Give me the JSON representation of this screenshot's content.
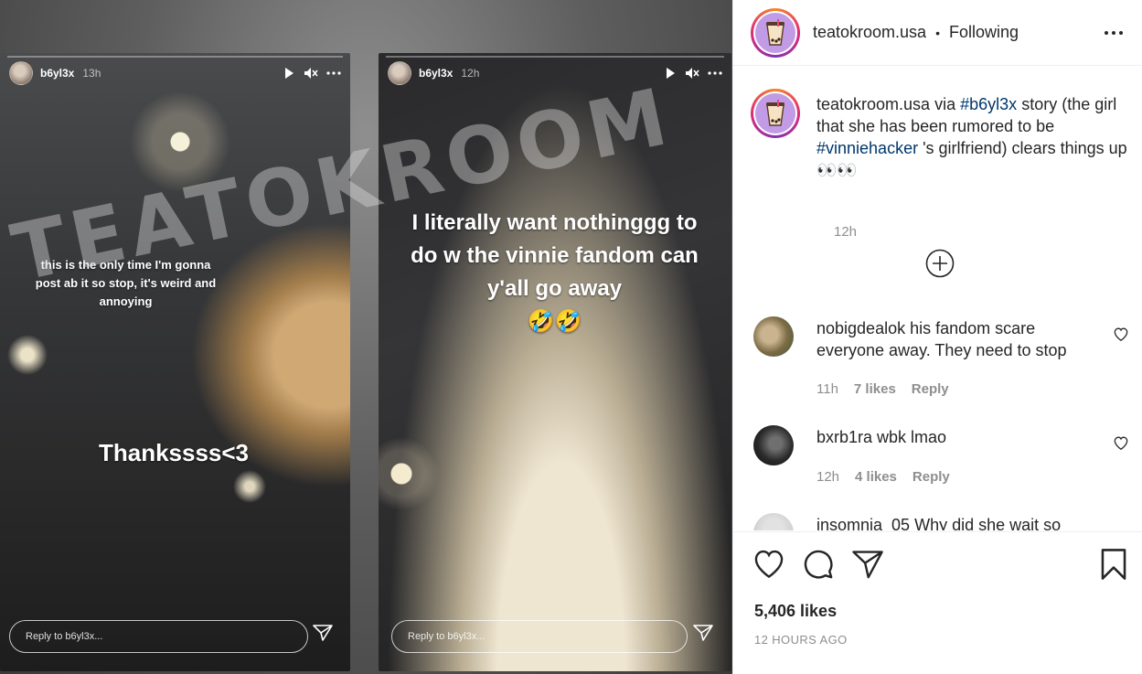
{
  "post": {
    "author": "teatokroom.usa",
    "follow_status": "Following",
    "header_separator": "•",
    "caption": {
      "username": "teatokroom.usa",
      "via": "via",
      "tag1": "#b6yl3x",
      "text1": "story (the girl that she has been rumored to be",
      "tag2": "#vinniehacker",
      "text2": "'s girlfriend) clears things up",
      "emoji": "👀👀",
      "time": "12h"
    },
    "likes": "5,406 likes",
    "posted_ago": "12 HOURS AGO"
  },
  "comments": [
    {
      "username": "nobigdealok",
      "text": "his fandom scare everyone away. They need to stop",
      "time": "11h",
      "likes": "7 likes",
      "reply": "Reply"
    },
    {
      "username": "bxrb1ra",
      "text": "wbk lmao",
      "time": "12h",
      "likes": "4 likes",
      "reply": "Reply"
    },
    {
      "username": "insomnia_05",
      "text": "Why did she wait so"
    }
  ],
  "stories": [
    {
      "user": "b6yl3x",
      "time": "13h",
      "caption_top": "this is the only time I'm gonna post ab it so stop, it's weird and annoying",
      "caption_bottom": "Thankssss<3",
      "reply_placeholder": "Reply to b6yl3x..."
    },
    {
      "user": "b6yl3x",
      "time": "12h",
      "caption_top": "I literally want nothinggg to do w the vinnie fandom can y'all go away",
      "emoji": "🤣🤣",
      "reply_placeholder": "Reply to b6yl3x..."
    }
  ],
  "watermark": "TEATOKROOM",
  "icons": {
    "more": "more-icon",
    "load_more": "plus-circle-icon",
    "like": "heart-icon",
    "comment": "comment-icon",
    "share": "paper-plane-icon",
    "save": "bookmark-icon",
    "play": "play-icon",
    "mute": "mute-icon"
  },
  "colors": {
    "link": "#00376b",
    "muted": "#8e8e8e",
    "text": "#262626",
    "logo_bg": "#c19be6"
  }
}
